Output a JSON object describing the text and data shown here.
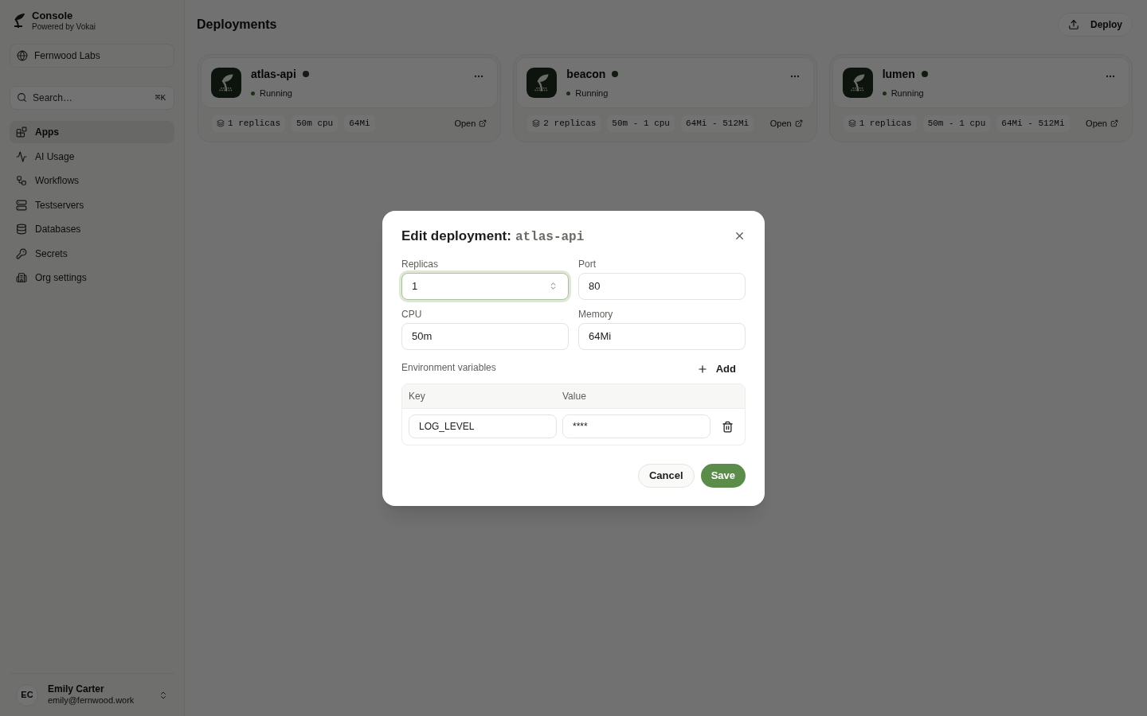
{
  "sidebar": {
    "brand": {
      "title": "Console",
      "subtitle": "Powered by Vokai"
    },
    "org": "Fernwood Labs",
    "search": {
      "placeholder": "Search…",
      "shortcut": "⌘K"
    },
    "nav": [
      {
        "label": "Apps",
        "selected": true
      },
      {
        "label": "AI Usage",
        "selected": false
      },
      {
        "label": "Workflows",
        "selected": false
      },
      {
        "label": "Testservers",
        "selected": false
      },
      {
        "label": "Databases",
        "selected": false
      },
      {
        "label": "Secrets",
        "selected": false
      },
      {
        "label": "Org settings",
        "selected": false
      }
    ],
    "user": {
      "initials": "EC",
      "name": "Emily Carter",
      "email": "emily@fernwood.work"
    }
  },
  "header": {
    "title": "Deployments",
    "action": "Deploy"
  },
  "deployments": [
    {
      "name": "atlas-api",
      "status": "Running",
      "specs": [
        "1 replicas",
        "50m cpu",
        "64Mi"
      ],
      "link": "Open"
    },
    {
      "name": "beacon",
      "status": "Running",
      "specs": [
        "2 replicas",
        "50m - 1 cpu",
        "64Mi - 512Mi"
      ],
      "link": "Open"
    },
    {
      "name": "lumen",
      "status": "Running",
      "specs": [
        "1 replicas",
        "50m - 1 cpu",
        "64Mi - 512Mi"
      ],
      "link": "Open"
    }
  ],
  "dialog": {
    "title": "Edit deployment:",
    "subject": "atlas-api",
    "fields": [
      {
        "label": "Replicas",
        "value": "1",
        "focused": true
      },
      {
        "label": "Port",
        "value": "80",
        "focused": false
      },
      {
        "label": "CPU",
        "value": "50m",
        "focused": false
      },
      {
        "label": "Memory",
        "value": "64Mi",
        "focused": false
      }
    ],
    "env": {
      "label": "Environment variables",
      "add": "Add",
      "columns": [
        "Key",
        "Value"
      ],
      "rows": [
        {
          "key": "LOG_LEVEL",
          "value": "****"
        }
      ]
    },
    "buttons": [
      {
        "label": "Cancel",
        "kind": "secondary"
      },
      {
        "label": "Save",
        "kind": "primary"
      }
    ]
  }
}
